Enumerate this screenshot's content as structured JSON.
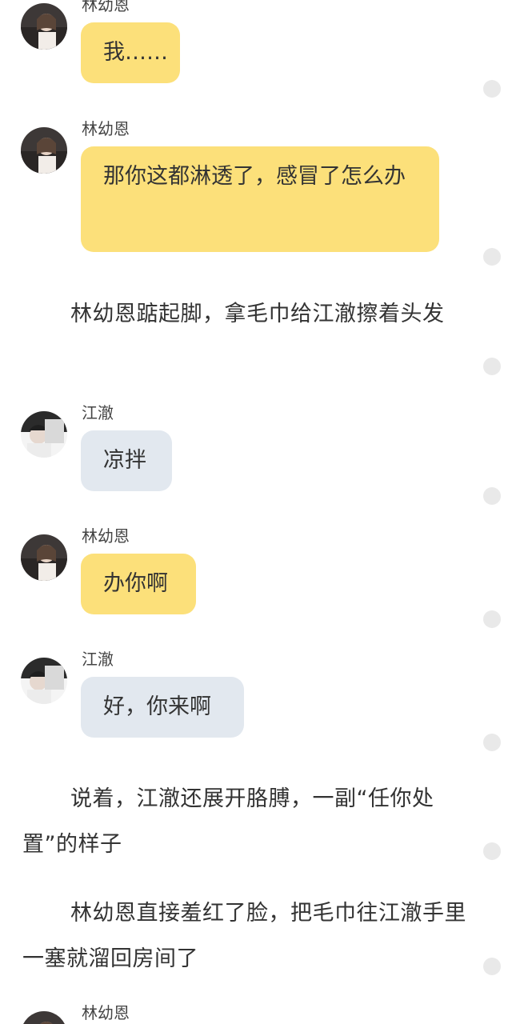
{
  "chat": {
    "messages": [
      {
        "sender": "林幼恩",
        "text": "我……",
        "style": "yellow"
      },
      {
        "sender": "林幼恩",
        "text": "那你这都淋透了，感冒了怎么办",
        "style": "yellow"
      },
      {
        "sender": "江澈",
        "text": "凉拌",
        "style": "blue"
      },
      {
        "sender": "林幼恩",
        "text": "办你啊",
        "style": "yellow"
      },
      {
        "sender": "江澈",
        "text": "好，你来啊",
        "style": "blue"
      },
      {
        "sender": "林幼恩",
        "text": "",
        "style": "yellow"
      }
    ],
    "narrations": [
      "林幼恩踮起脚，拿毛巾给江澈擦着头发",
      "说着，江澈还展开胳膊，一副“任你处置”的样子",
      "林幼恩直接羞红了脸，把毛巾往江澈手里一塞就溜回房间了"
    ]
  },
  "colors": {
    "bubble_yellow": "#fce07a",
    "bubble_blue": "#e2e8ef",
    "dot": "#e9e9e9"
  }
}
